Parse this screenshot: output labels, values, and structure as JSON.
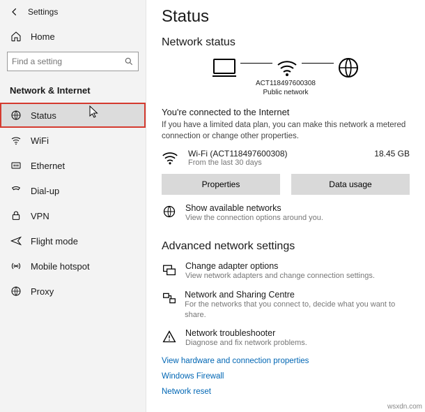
{
  "topbar": {
    "title": "Settings"
  },
  "home_label": "Home",
  "search": {
    "placeholder": "Find a setting"
  },
  "section_label": "Network & Internet",
  "sidebar": {
    "items": [
      {
        "label": "Status"
      },
      {
        "label": "WiFi"
      },
      {
        "label": "Ethernet"
      },
      {
        "label": "Dial-up"
      },
      {
        "label": "VPN"
      },
      {
        "label": "Flight mode"
      },
      {
        "label": "Mobile hotspot"
      },
      {
        "label": "Proxy"
      }
    ]
  },
  "main": {
    "title": "Status",
    "subtitle": "Network status",
    "diagram": {
      "network_name": "ACT118497600308",
      "network_type": "Public network"
    },
    "connected": {
      "title": "You're connected to the Internet",
      "desc": "If you have a limited data plan, you can make this network a metered connection or change other properties.",
      "conn_name": "Wi-Fi (ACT118497600308)",
      "conn_sub": "From the last 30 days",
      "usage": "18.45 GB"
    },
    "buttons": {
      "properties": "Properties",
      "data_usage": "Data usage"
    },
    "show_available": {
      "title": "Show available networks",
      "desc": "View the connection options around you."
    },
    "advanced_title": "Advanced network settings",
    "advanced": [
      {
        "title": "Change adapter options",
        "desc": "View network adapters and change connection settings."
      },
      {
        "title": "Network and Sharing Centre",
        "desc": "For the networks that you connect to, decide what you want to share."
      },
      {
        "title": "Network troubleshooter",
        "desc": "Diagnose and fix network problems."
      }
    ],
    "links": [
      "View hardware and connection properties",
      "Windows Firewall",
      "Network reset"
    ]
  },
  "watermark": "wsxdn.com"
}
